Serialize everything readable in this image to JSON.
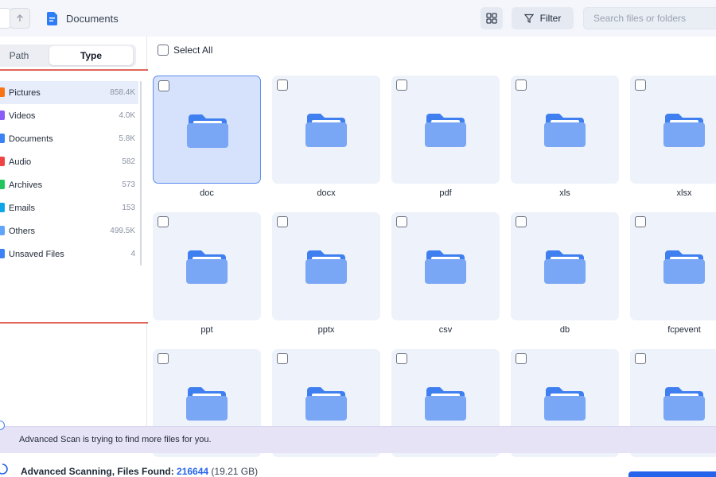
{
  "header": {
    "breadcrumb": "Documents",
    "filter_label": "Filter",
    "search_placeholder": "Search files or folders"
  },
  "sidebar": {
    "tabs": [
      "Path",
      "Type"
    ],
    "active_tab": "Type",
    "types": [
      {
        "label": "Pictures",
        "count": "858.4K",
        "icon": "pictures-icon",
        "color": "#f97316"
      },
      {
        "label": "Videos",
        "count": "4.0K",
        "icon": "videos-icon",
        "color": "#8b5cf6"
      },
      {
        "label": "Documents",
        "count": "5.8K",
        "icon": "documents-icon",
        "color": "#3b82f6"
      },
      {
        "label": "Audio",
        "count": "582",
        "icon": "audio-icon",
        "color": "#ef4444"
      },
      {
        "label": "Archives",
        "count": "573",
        "icon": "archives-icon",
        "color": "#22c55e"
      },
      {
        "label": "Emails",
        "count": "153",
        "icon": "emails-icon",
        "color": "#0ea5e9"
      },
      {
        "label": "Others",
        "count": "499.5K",
        "icon": "others-icon",
        "color": "#60a5fa"
      },
      {
        "label": "Unsaved Files",
        "count": "4",
        "icon": "unsaved-files-icon",
        "color": "#3b82f6"
      }
    ]
  },
  "main": {
    "select_all_label": "Select All",
    "folders": [
      {
        "label": "doc",
        "selected": true
      },
      {
        "label": "docx"
      },
      {
        "label": "pdf"
      },
      {
        "label": "xls"
      },
      {
        "label": "xlsx"
      },
      {
        "label": "ppt"
      },
      {
        "label": "pptx"
      },
      {
        "label": "csv"
      },
      {
        "label": "db"
      },
      {
        "label": "fcpevent"
      },
      {
        "label": ""
      },
      {
        "label": ""
      },
      {
        "label": ""
      },
      {
        "label": ""
      },
      {
        "label": ""
      }
    ]
  },
  "scan_banner": {
    "message": "Advanced Scan is trying to find more files for you."
  },
  "footer": {
    "status_label": "Advanced Scanning, Files Found: ",
    "files_found": "216644",
    "total_size": "(19.21 GB)"
  },
  "colors": {
    "accent": "#2563eb",
    "highlight_border": "#e0665a",
    "folder": "#7aa7f5"
  }
}
